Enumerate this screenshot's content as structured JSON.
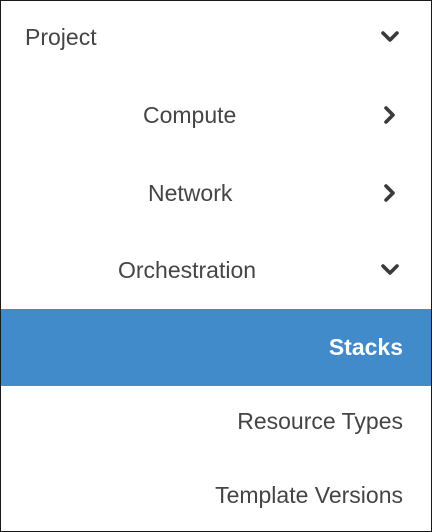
{
  "nav": {
    "project": {
      "label": "Project",
      "icon": "chevron-down-icon"
    },
    "compute": {
      "label": "Compute",
      "icon": "chevron-right-icon"
    },
    "network": {
      "label": "Network",
      "icon": "chevron-right-icon"
    },
    "orchestration": {
      "label": "Orchestration",
      "icon": "chevron-down-icon",
      "items": [
        {
          "label": "Stacks",
          "active": true
        },
        {
          "label": "Resource Types",
          "active": false
        },
        {
          "label": "Template Versions",
          "active": false
        }
      ]
    }
  },
  "colors": {
    "active_bg": "#428bca",
    "active_text": "#ffffff",
    "text": "#454545",
    "border": "#1a1a1a"
  }
}
